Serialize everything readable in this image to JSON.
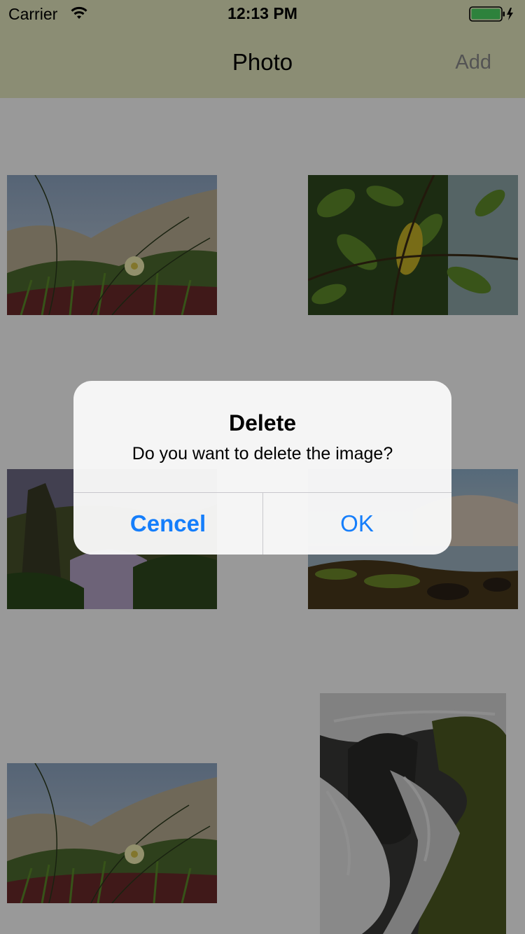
{
  "status_bar": {
    "carrier": "Carrier",
    "time": "12:13 PM",
    "wifi_icon": "wifi-icon",
    "battery_icon": "battery-charging-icon"
  },
  "nav_bar": {
    "title": "Photo",
    "add_label": "Add",
    "background": "#e8ecc2"
  },
  "photos": [
    {
      "subject": "dune-flower"
    },
    {
      "subject": "green-leaves"
    },
    {
      "subject": "coastal-rocks"
    },
    {
      "subject": "misty-shore"
    },
    {
      "subject": "dune-flower"
    },
    {
      "subject": "waterfall"
    }
  ],
  "alert": {
    "title": "Delete",
    "message": "Do you want to delete the image?",
    "cancel_label": "Cencel",
    "ok_label": "OK",
    "button_color": "#157efb"
  }
}
